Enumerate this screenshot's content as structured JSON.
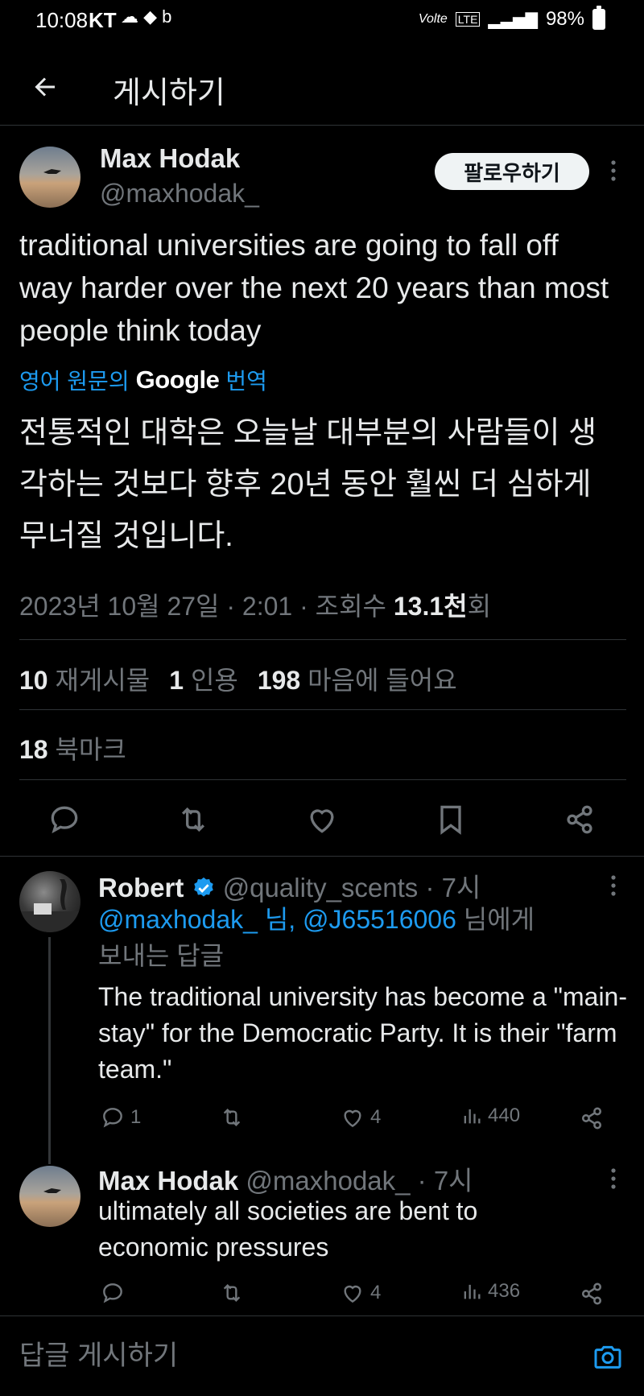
{
  "status_bar": {
    "time": "10:08",
    "carrier": "KT",
    "battery": "98%",
    "network": "LTE"
  },
  "header": {
    "title": "게시하기"
  },
  "tweet": {
    "author_name": "Max Hodak",
    "author_handle": "@maxhodak_",
    "follow_label": "팔로우하기",
    "text": "traditional universities are going to fall off way harder over the next 20 years than most people think today",
    "translate_prefix": "영어 원문의",
    "translate_brand": "Google",
    "translate_suffix": "번역",
    "translated_text": "전통적인 대학은 오늘날 대부분의 사람들이 생각하는 것보다 향후 20년 동안 훨씬 더 심하게 무너질 것입니다.",
    "date": "2023년 10월 27일 · 2:01 · 조회수 ",
    "views": "13.1천",
    "views_suffix": "회",
    "reposts_count": "10",
    "reposts_label": "재게시물",
    "quotes_count": "1",
    "quotes_label": "인용",
    "likes_count": "198",
    "likes_label": "마음에 들어요",
    "bookmarks_count": "18",
    "bookmarks_label": "북마크"
  },
  "replies": [
    {
      "name": "Robert",
      "handle": "@quality_scents",
      "time": "· 7시",
      "verified": true,
      "mention_1": "@maxhodak_ 님, @J65516006",
      "mention_2": "님에게",
      "replying_to": "보내는 답글",
      "text": "The traditional university has become a \"main-stay\" for the Democratic Party. It is their \"farm team.\"",
      "replies": "1",
      "retweets": "",
      "likes": "4",
      "views": "440"
    },
    {
      "name": "Max Hodak",
      "handle": "@maxhodak_",
      "time": "· 7시",
      "verified": false,
      "text": "ultimately all societies are bent to economic pressures",
      "replies": "",
      "retweets": "",
      "likes": "4",
      "views": "436"
    }
  ],
  "compose": {
    "placeholder": "답글 게시하기"
  },
  "colors": {
    "accent": "#1d9bf0",
    "background": "#000000",
    "muted": "#71767b",
    "text": "#e7e9ea"
  },
  "icons": [
    "back-arrow-icon",
    "more-icon",
    "reply-icon",
    "retweet-icon",
    "like-icon",
    "bookmark-icon",
    "share-icon",
    "views-icon",
    "verified-icon",
    "camera-icon"
  ]
}
